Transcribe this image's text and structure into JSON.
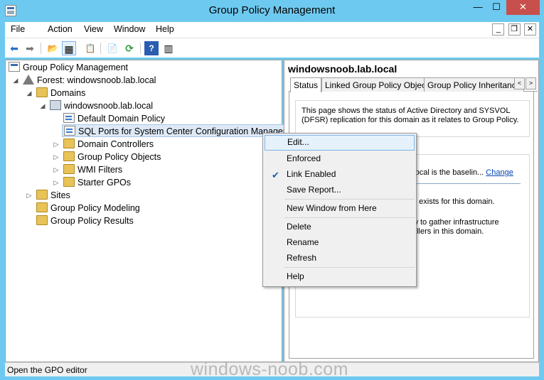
{
  "window": {
    "title": "Group Policy Management",
    "buttons": {
      "minimize": "—",
      "maximize": "☐",
      "close": "✕"
    }
  },
  "menubar": {
    "items": [
      "File",
      "Action",
      "View",
      "Window",
      "Help"
    ],
    "mdi_buttons": {
      "minimize": "_",
      "restore": "❐",
      "close": "✕"
    }
  },
  "toolbar": {
    "icons": [
      "back-arrow-icon",
      "forward-arrow-icon",
      "up-folder-icon",
      "show-hide-tree-icon",
      "clipboard-icon",
      "export-list-icon",
      "refresh-icon",
      "help-icon",
      "show-action-pane-icon"
    ],
    "glyphs": {
      "back": "⬅",
      "forward": "➡",
      "up": "📂",
      "tree": "▦",
      "clip": "📋",
      "export": "📄",
      "refresh": "⟳",
      "help": "?",
      "action": "▥"
    }
  },
  "tree": {
    "root": "Group Policy Management",
    "forest": "Forest: windowsnoob.lab.local",
    "domains": "Domains",
    "domain": "windowsnoob.lab.local",
    "default_domain_policy": "Default Domain Policy",
    "sql_gpo": "SQL Ports for System Center Configuration Manager",
    "domain_controllers": "Domain Controllers",
    "gpo_folder": "Group Policy Objects",
    "wmi_filters": "WMI Filters",
    "starter_gpos": "Starter GPOs",
    "sites": "Sites",
    "modeling": "Group Policy Modeling",
    "results": "Group Policy Results",
    "expanded_glyph": "◢",
    "collapsed_glyph": "▷"
  },
  "details": {
    "title": "windowsnoob.lab.local",
    "tabs": [
      "Status",
      "Linked Group Policy Objects",
      "Group Policy Inheritance"
    ],
    "tab_scroll": {
      "left": "<",
      "right": ">"
    },
    "status_text": "This page shows the status of Active Directory and SYSVOL (DFSR) replication for this domain as it relates to Group Policy.",
    "baseline_fragment": "b.local is the baselin...",
    "change_link": "Change",
    "exists_fragment": "n exists for this domain.",
    "gather_fragment_1": "w to gather infrastructure",
    "gather_fragment_2": "ollers in this domain."
  },
  "context_menu": {
    "items": [
      "Edit...",
      "Enforced",
      "Link Enabled",
      "Save Report...",
      "New Window from Here",
      "Delete",
      "Rename",
      "Refresh",
      "Help"
    ],
    "highlighted": "Edit...",
    "checked": "Link Enabled",
    "check_glyph": "✔"
  },
  "statusbar": {
    "text": "Open the GPO editor"
  },
  "watermark": "windows-noob.com",
  "colors": {
    "chrome": "#6ec9f0",
    "close_button": "#c7504c",
    "selection": "#dde9f6",
    "menu_highlight": "#e5f1fb"
  }
}
